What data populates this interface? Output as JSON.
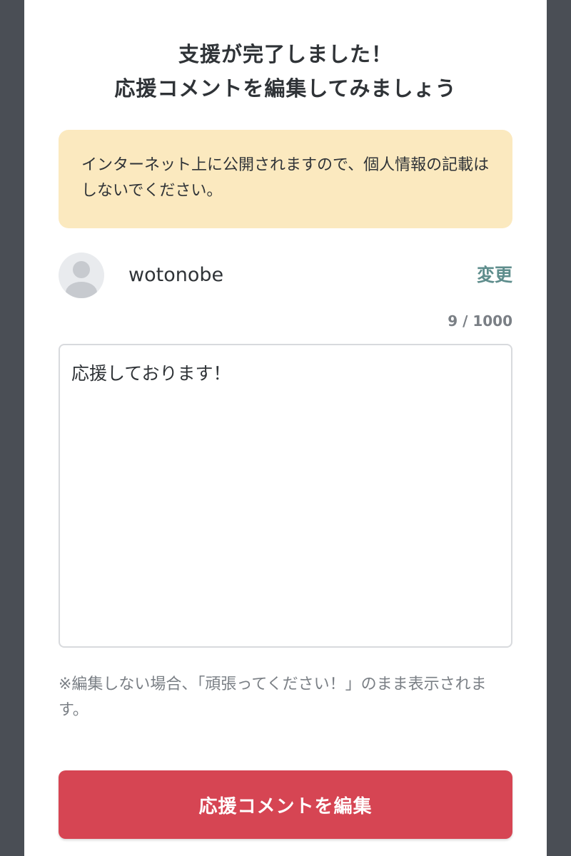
{
  "header": {
    "title_line1": "支援が完了しました！",
    "title_line2": "応援コメントを編集してみましょう"
  },
  "notice": {
    "text": "インターネット上に公開されますので、個人情報の記載はしないでください。"
  },
  "user": {
    "avatar_icon": "user-avatar-icon",
    "name": "wotonobe",
    "change_label": "変更"
  },
  "comment": {
    "count": "9 / 1000",
    "value": "応援しております！"
  },
  "note": {
    "text": "※編集しない場合、「頑張ってください！」のまま表示されます。"
  },
  "actions": {
    "submit_label": "応援コメントを編集"
  },
  "colors": {
    "backdrop": "#4a4e55",
    "notice_bg": "#fbe9bf",
    "link": "#5e8d8c",
    "primary_button": "#d64553"
  }
}
